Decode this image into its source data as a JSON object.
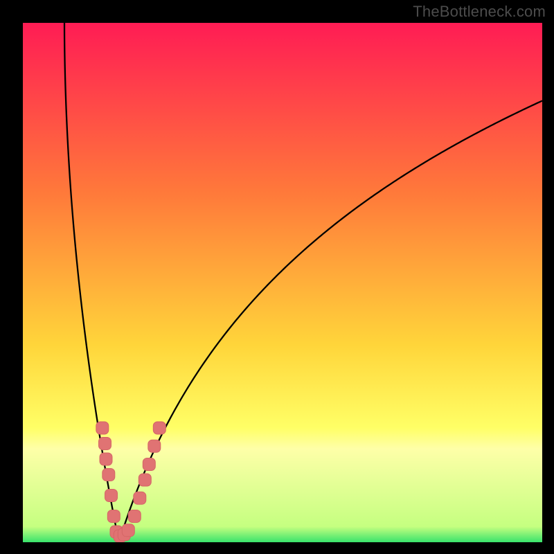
{
  "watermark": "TheBottleneck.com",
  "colors": {
    "frame": "#000000",
    "watermark": "#4c4c4c",
    "curve": "#000000",
    "marker_fill": "#e07373",
    "marker_stroke": "#d46666",
    "grad_top": "#ff1c54",
    "grad_mid1": "#ff6e3a",
    "grad_mid2": "#ffd53a",
    "grad_mid3": "#ffff66",
    "grad_pale_band": "#feffa8",
    "grad_bottom": "#39e36c"
  },
  "chart_data": {
    "type": "line",
    "title": "",
    "xlabel": "",
    "ylabel": "",
    "xlim": [
      0,
      100
    ],
    "ylim": [
      0,
      100
    ],
    "series": [
      {
        "name": "left-descending-curve",
        "x_at_y100": 8,
        "x_at_y0": 18.5,
        "curvature": "concave-right",
        "note": "steep curve descending from top edge to bottom near x≈18.5"
      },
      {
        "name": "right-ascending-curve",
        "x_at_y0": 18.5,
        "y_at_x100": 85,
        "curvature": "logarithmic",
        "note": "curve rising from the bottom minimum toward upper-right, flattening"
      }
    ],
    "markers": {
      "name": "highlight-points",
      "shape": "rounded-square",
      "color": "#e07373",
      "note": "clustered points along the V-notch between y≈0 and y≈22 on both branches",
      "points": [
        {
          "x": 15.3,
          "y": 22.0
        },
        {
          "x": 15.8,
          "y": 19.0
        },
        {
          "x": 16.0,
          "y": 16.0
        },
        {
          "x": 16.5,
          "y": 13.0
        },
        {
          "x": 17.0,
          "y": 9.0
        },
        {
          "x": 17.5,
          "y": 5.0
        },
        {
          "x": 18.0,
          "y": 2.0
        },
        {
          "x": 18.7,
          "y": 1.2
        },
        {
          "x": 19.5,
          "y": 1.5
        },
        {
          "x": 20.3,
          "y": 2.3
        },
        {
          "x": 21.5,
          "y": 5.0
        },
        {
          "x": 22.5,
          "y": 8.5
        },
        {
          "x": 23.5,
          "y": 12.0
        },
        {
          "x": 24.3,
          "y": 15.0
        },
        {
          "x": 25.3,
          "y": 18.5
        },
        {
          "x": 26.3,
          "y": 22.0
        }
      ]
    },
    "background": {
      "type": "vertical-gradient",
      "stops": [
        {
          "y_pct": 0,
          "color": "#ff1c54"
        },
        {
          "y_pct": 33,
          "color": "#ff7a3a"
        },
        {
          "y_pct": 62,
          "color": "#ffd53a"
        },
        {
          "y_pct": 78,
          "color": "#ffff66"
        },
        {
          "y_pct": 82,
          "color": "#feffa8"
        },
        {
          "y_pct": 97,
          "color": "#c5ff80"
        },
        {
          "y_pct": 100,
          "color": "#39e36c"
        }
      ]
    }
  }
}
